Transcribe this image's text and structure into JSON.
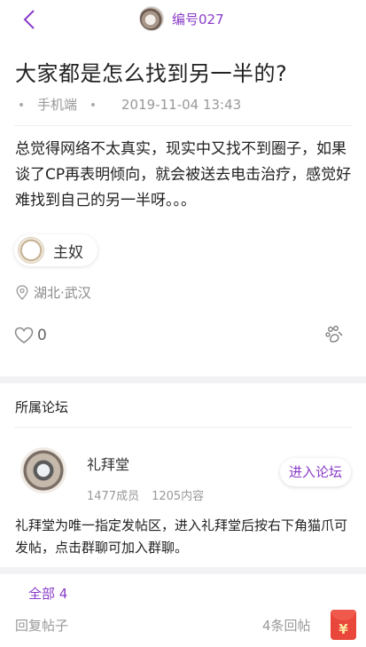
{
  "header": {
    "author_name": "编号027",
    "back_icon": "back-chevron-icon"
  },
  "post": {
    "title": "大家都是怎么找到另一半的?",
    "platform": "手机端",
    "time": "2019-11-04 13:43",
    "body": "总觉得网络不太真实，现实中又找不到圈子，如果谈了CP再表明倾向，就会被送去电击治疗，感觉好难找到自己的另一半呀。。。",
    "tag": "主奴",
    "location": "湖北·武汉",
    "likes": "0"
  },
  "forum": {
    "heading": "所属论坛",
    "name": "礼拜堂",
    "members": "1477成员",
    "contents": "1205内容",
    "enter_label": "进入论坛",
    "description": "礼拜堂为唯一指定发帖区，进入礼拜堂后按右下角猫爪可发帖，点击群聊可加入群聊。"
  },
  "comments": {
    "tab_all": "全部 4",
    "reply_label": "回复帖子",
    "reply_count": "4条回帖",
    "redpacket_symbol": "¥"
  },
  "colors": {
    "accent": "#8a3cc8",
    "redpacket": "#e9473b"
  }
}
